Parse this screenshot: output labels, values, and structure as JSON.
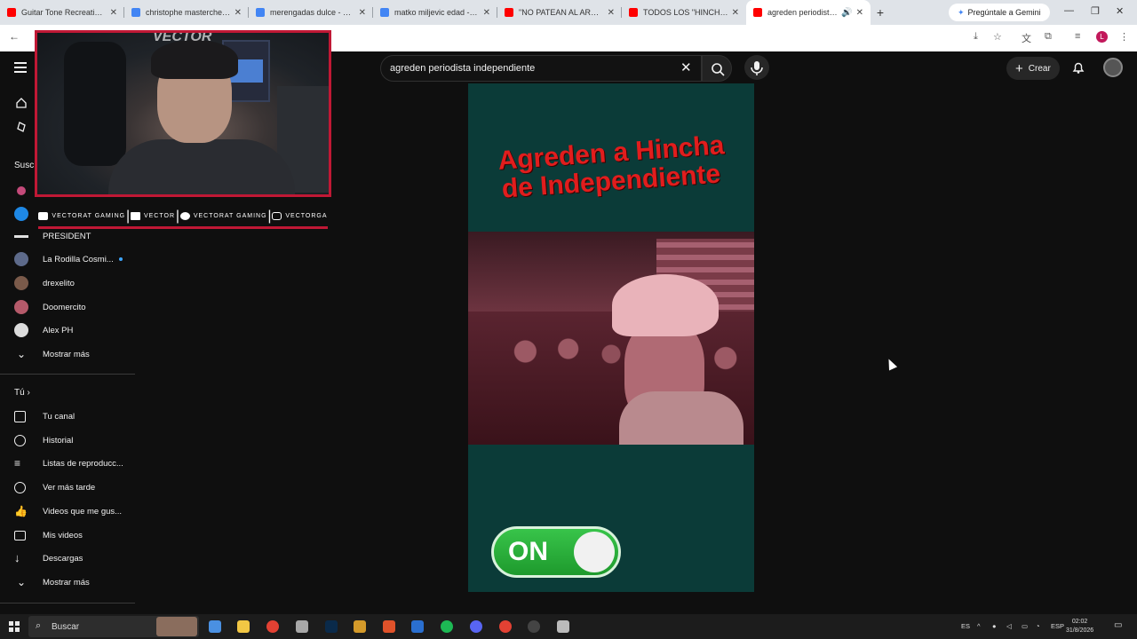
{
  "browser": {
    "tabs": [
      {
        "title": "Guitar Tone Recreation | A",
        "favicon_color": "#ff0000"
      },
      {
        "title": "christophe masterchef - B",
        "favicon_color": "#4285f4"
      },
      {
        "title": "merengadas dulce - Busc",
        "favicon_color": "#4285f4"
      },
      {
        "title": "matko miljevic edad - Bus",
        "favicon_color": "#4285f4"
      },
      {
        "title": "\"NO PATEAN AL ARCO\" 🔥",
        "favicon_color": "#ff0000"
      },
      {
        "title": "TODOS LOS \"HINCHAS KI",
        "favicon_color": "#ff0000"
      },
      {
        "title": "agreden periodista in",
        "favicon_color": "#ff0000"
      }
    ],
    "new_tab": "+",
    "gemini_label": "Pregúntale a Gemini",
    "profile_initial": "L",
    "window_minimize": "—",
    "window_restore": "❐",
    "window_close": "✕"
  },
  "youtube": {
    "search_value": "agreden periodista independiente",
    "create_label": "Crear"
  },
  "sidebar": {
    "subs_header": "Susc",
    "subscriptions": [
      {
        "label": "PRESIDENT",
        "color": "#e0e0e0"
      },
      {
        "label": "La Rodilla Cosmi...",
        "color": "#5d6a8a",
        "live": true
      },
      {
        "label": "drexelito",
        "color": "#7a5a4a"
      },
      {
        "label": "Doomercito",
        "color": "#b55a6a"
      },
      {
        "label": "Alex PH",
        "color": "#dcdcdc"
      }
    ],
    "show_more_1": "Mostrar más",
    "you_header": "Tú",
    "you_items": [
      {
        "label": "Tu canal",
        "icon": "channel-icon"
      },
      {
        "label": "Historial",
        "icon": "history-icon"
      },
      {
        "label": "Listas de reproducc...",
        "icon": "playlist-icon"
      },
      {
        "label": "Ver más tarde",
        "icon": "clock-icon"
      },
      {
        "label": "Videos que me gus...",
        "icon": "thumb-up-icon"
      },
      {
        "label": "Mis videos",
        "icon": "my-videos-icon"
      },
      {
        "label": "Descargas",
        "icon": "download-icon"
      }
    ],
    "show_more_2": "Mostrar más"
  },
  "webcam": {
    "logo_text": "VECTOR",
    "socials": [
      {
        "text": "VECTORAT GAMING",
        "icon": "youtube-icon"
      },
      {
        "text": "VECTOR",
        "icon": "twitch-icon"
      },
      {
        "text": "VECTORAT GAMING",
        "icon": "twitter-icon"
      },
      {
        "text": "VECTORGA",
        "icon": "instagram-icon"
      }
    ]
  },
  "short": {
    "title_line1": "Agreden a Hincha",
    "title_line2": "de Independiente",
    "toggle_label": "ON"
  },
  "taskbar": {
    "search_placeholder": "Buscar",
    "lang": "ES",
    "lang2": "ESP",
    "time": "02:02",
    "date": "31/8/2026"
  }
}
